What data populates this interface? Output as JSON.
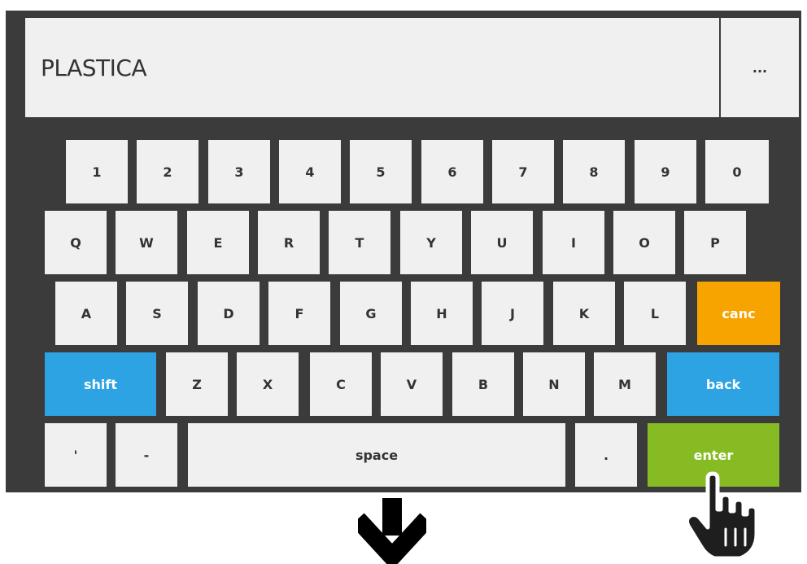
{
  "display": {
    "value": "PLASTICA",
    "menu_label": "..."
  },
  "keyboard": {
    "row1": [
      "1",
      "2",
      "3",
      "4",
      "5",
      "6",
      "7",
      "8",
      "9",
      "0"
    ],
    "row2": [
      "Q",
      "W",
      "E",
      "R",
      "T",
      "Y",
      "U",
      "I",
      "O",
      "P"
    ],
    "row3": [
      "A",
      "S",
      "D",
      "F",
      "G",
      "H",
      "J",
      "K",
      "L"
    ],
    "row4": [
      "Z",
      "X",
      "C",
      "V",
      "B",
      "N",
      "M"
    ],
    "canc": "canc",
    "shift": "shift",
    "back": "back",
    "apostrophe": "'",
    "dash": "-",
    "space": "space",
    "dot": ".",
    "enter": "enter"
  },
  "colors": {
    "panel": "#3b3b3b",
    "key": "#f0f0f0",
    "blue": "#2ea3e3",
    "orange": "#f7a300",
    "green": "#86bb24"
  },
  "icons": {
    "arrow": "arrow-down-icon",
    "pointer": "hand-pointer-icon"
  }
}
